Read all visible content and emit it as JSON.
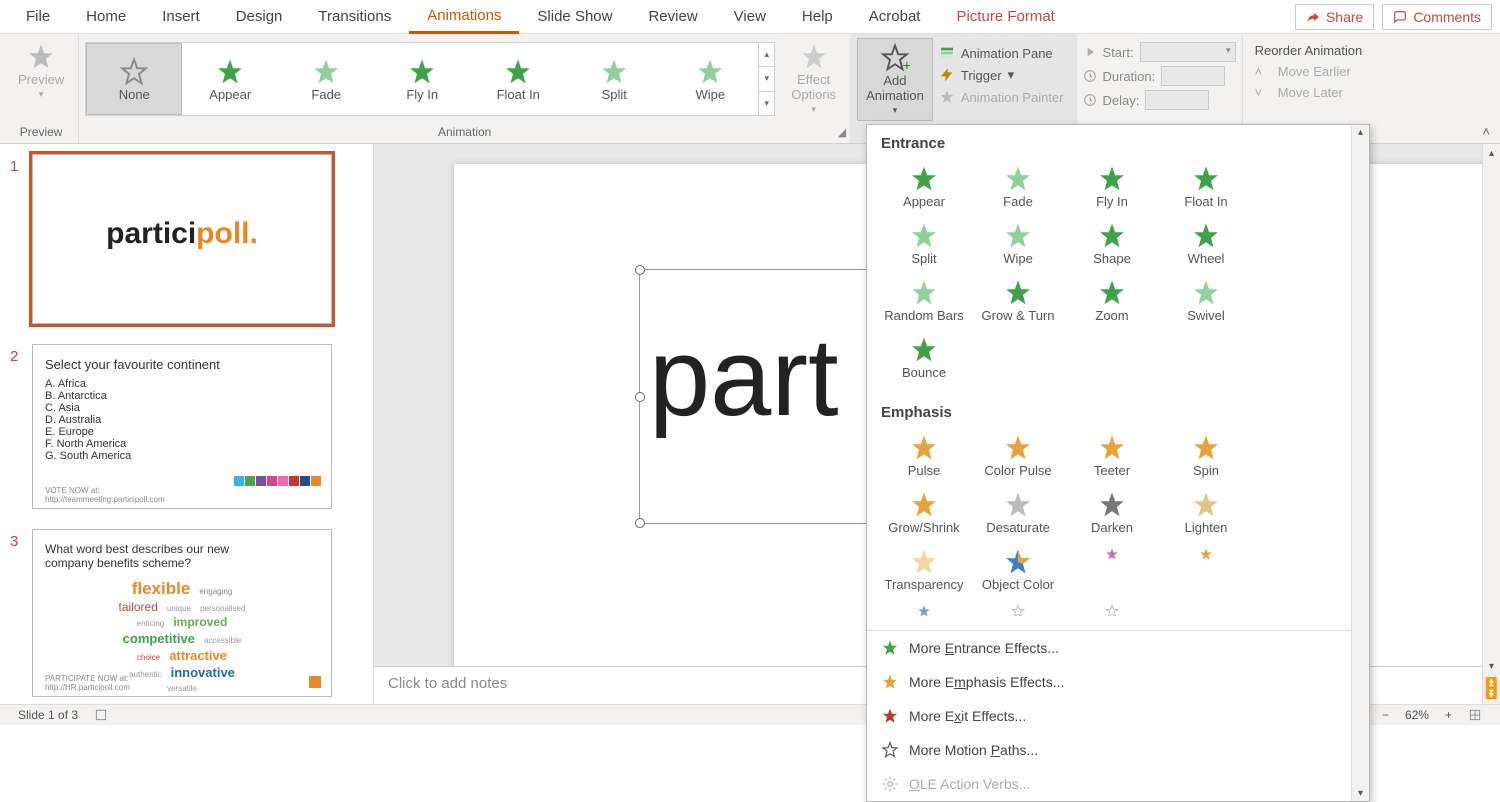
{
  "menubar": {
    "tabs": [
      "File",
      "Home",
      "Insert",
      "Design",
      "Transitions",
      "Animations",
      "Slide Show",
      "Review",
      "View",
      "Help",
      "Acrobat",
      "Picture Format"
    ],
    "active_index": 5,
    "context_index": 11,
    "share": "Share",
    "comments": "Comments"
  },
  "ribbon": {
    "preview_btn": "Preview",
    "preview_group": "Preview",
    "animation_group": "Animation",
    "gallery": [
      "None",
      "Appear",
      "Fade",
      "Fly In",
      "Float In",
      "Split",
      "Wipe"
    ],
    "gallery_selected": 0,
    "effect_options": "Effect\nOptions",
    "add_animation": "Add\nAnimation",
    "animation_pane": "Animation Pane",
    "trigger": "Trigger",
    "animation_painter": "Animation Painter",
    "start": "Start:",
    "duration": "Duration:",
    "delay": "Delay:",
    "reorder": "Reorder Animation",
    "move_earlier": "Move Earlier",
    "move_later": "Move Later"
  },
  "dropdown": {
    "entrance_title": "Entrance",
    "entrance": [
      "Appear",
      "Fade",
      "Fly In",
      "Float In",
      "Split",
      "Wipe",
      "Shape",
      "Wheel",
      "Random Bars",
      "Grow & Turn",
      "Zoom",
      "Swivel",
      "Bounce"
    ],
    "emphasis_title": "Emphasis",
    "emphasis": [
      "Pulse",
      "Color Pulse",
      "Teeter",
      "Spin",
      "Grow/Shrink",
      "Desaturate",
      "Darken",
      "Lighten",
      "Transparency",
      "Object Color"
    ],
    "more_entrance": "More Entrance Effects...",
    "more_emphasis": "More Emphasis Effects...",
    "more_exit": "More Exit Effects...",
    "more_motion": "More Motion Paths...",
    "ole": "OLE Action Verbs...",
    "u_entrance": "E",
    "u_emphasis": "m",
    "u_exit": "x",
    "u_motion": "P",
    "u_ole": "O"
  },
  "thumbs": {
    "logo_a": "partici",
    "logo_b": "poll",
    "logo_dot": ".",
    "slide2_title": "Select your favourite continent",
    "slide2_opts": [
      "A.  Africa",
      "B.  Antarctica",
      "C.  Asia",
      "D.  Australia",
      "E.  Europe",
      "F.  North America",
      "G.  South America"
    ],
    "slide2_foot1": "VOTE NOW at:",
    "slide2_foot2": "http://teammeeting.participoll.com",
    "slide3_q": "What word best describes our new company benefits scheme?",
    "slide3_foot1": "PARTICIPATE NOW at:",
    "slide3_foot2": "http://HR.participoll.com",
    "wc": {
      "flexible": "flexible",
      "engaging": "engaging",
      "tailored": "tailored",
      "unique": "unique",
      "personalised": "personalised",
      "enticing": "enticing",
      "improved": "improved",
      "competitive": "competitive",
      "attractive": "attractive",
      "accessible": "accessible",
      "authentic": "authentic",
      "innovative": "innovative",
      "versatile": "versatile",
      "choice": "choice"
    }
  },
  "editor": {
    "visible_text": "part",
    "notes_placeholder": "Click to add notes"
  },
  "status": {
    "slide": "Slide 1 of 3",
    "zoom": "62%"
  }
}
